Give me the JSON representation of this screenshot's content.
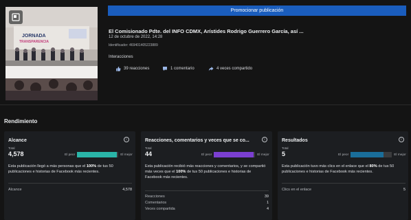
{
  "promote_button": "Promocionar publicación",
  "post": {
    "title": "El Comisionado Pdte. del INFO CDMX, Arístides Rodrigo Guerrero García, así ...",
    "date": "12 de octubre de 2022, 14:28",
    "identifier": "Identificador: 469401405223889",
    "interactions_heading": "Interacciones",
    "reactions": "39 reacciones",
    "comments": "1 comentario",
    "shares": "4 veces compartido"
  },
  "thumbnail": {
    "banner_line1": "JORNADA",
    "banner_line2": "TRANSPARENCIA"
  },
  "section_title": "Rendimiento",
  "cards": [
    {
      "title": "Alcance",
      "total_label": "Total",
      "total_value": "4,578",
      "worse_label": "El peor",
      "better_label": "El mejor",
      "bar_fraction": 0.96,
      "bar_color": "#2ab5a8",
      "desc_before": "Esta publicación llegó a más personas que el ",
      "desc_pct": "100%",
      "desc_after": " de tus 50 publicaciones e historias de Facebook más recientes.",
      "rows": [
        {
          "label": "Alcance",
          "value": "4,578"
        }
      ]
    },
    {
      "title": "Reacciones, comentarios y veces que se co...",
      "total_label": "Total",
      "total_value": "44",
      "worse_label": "El peor",
      "better_label": "El mejor",
      "bar_fraction": 0.96,
      "bar_color": "#7b3fd1",
      "desc_before": "Esta publicación recibió más reacciones y comentarios, y se compartió más veces que el ",
      "desc_pct": "100%",
      "desc_after": " de tus 50 publicaciones e historias de Facebook más recientes.",
      "rows": [
        {
          "label": "Reacciones",
          "value": "39"
        },
        {
          "label": "Comentarios",
          "value": "1"
        },
        {
          "label": "Veces compartida",
          "value": "4"
        }
      ]
    },
    {
      "title": "Resultados",
      "total_label": "Total",
      "total_value": "5",
      "worse_label": "El peor",
      "better_label": "El mejor",
      "bar_fraction": 0.8,
      "bar_color": "#1a6e9a",
      "desc_before": "Esta publicación tuvo más clics en el enlace que el ",
      "desc_pct": "80%",
      "desc_after": " de tus 50 publicaciones e historias de Facebook más recientes.",
      "rows": [
        {
          "label": "Clics en el enlace",
          "value": "5"
        }
      ]
    }
  ],
  "colors": {
    "accent_blue": "#1a5dbd",
    "background": "#141414",
    "card": "#1c1e21"
  }
}
